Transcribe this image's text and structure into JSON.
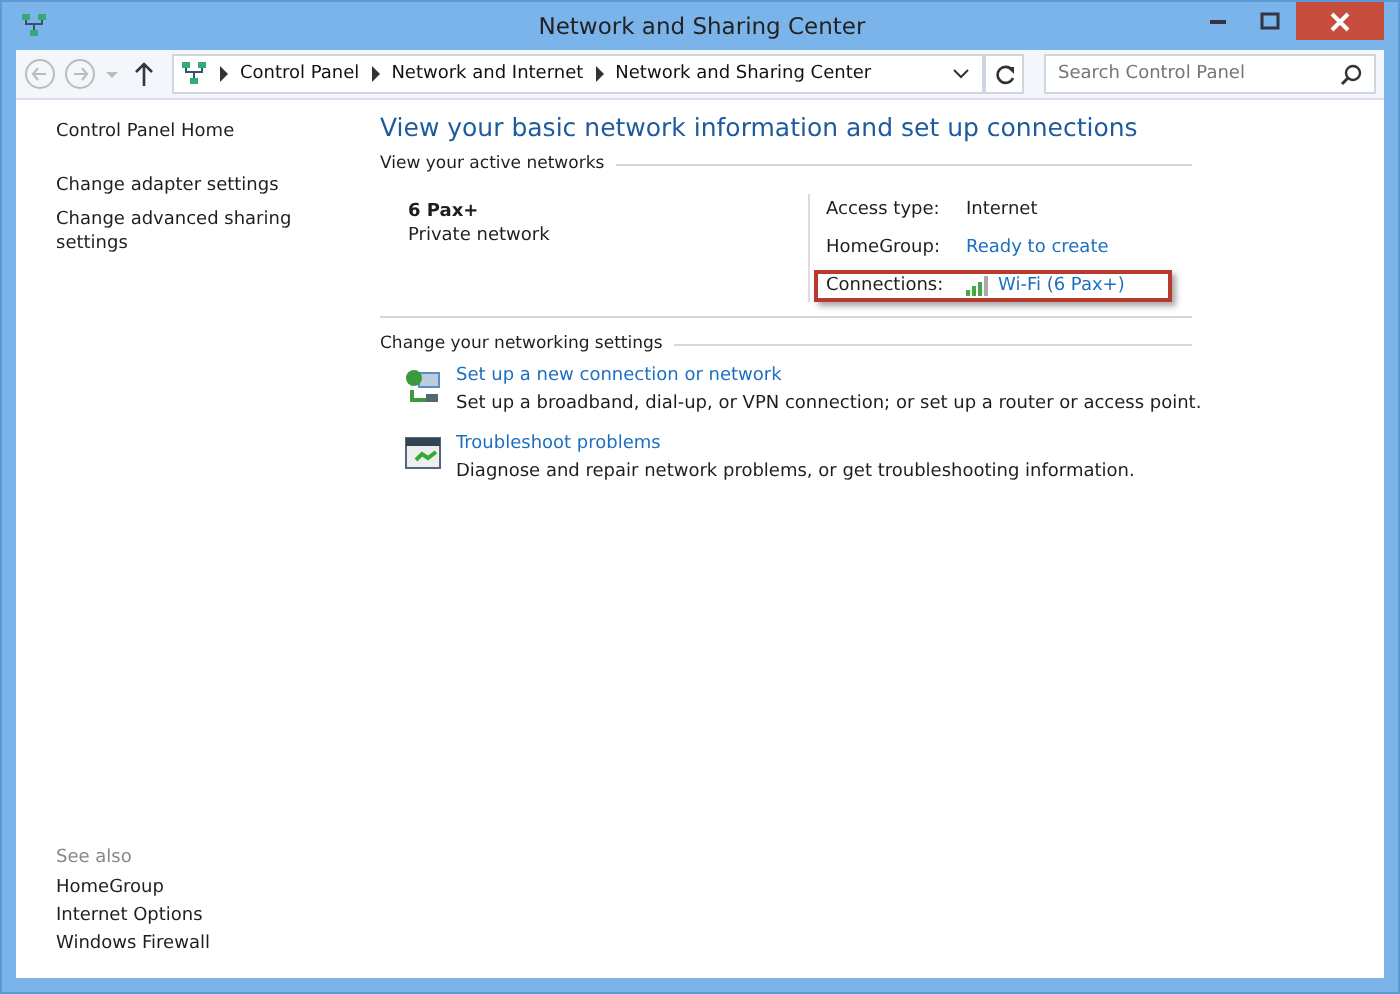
{
  "window": {
    "title": "Network and Sharing Center"
  },
  "address_bar": {
    "breadcrumb": [
      "Control Panel",
      "Network and Internet",
      "Network and Sharing Center"
    ]
  },
  "search": {
    "placeholder": "Search Control Panel"
  },
  "sidebar": {
    "items": [
      "Control Panel Home",
      "Change adapter settings",
      "Change advanced sharing settings"
    ],
    "see_also_heading": "See also",
    "see_also": [
      "HomeGroup",
      "Internet Options",
      "Windows Firewall"
    ]
  },
  "heading": "View your basic network information and set up connections",
  "active_networks": {
    "title": "View your active networks",
    "name": "6 Pax+",
    "type": "Private network",
    "details": [
      {
        "label": "Access type:",
        "value": "Internet",
        "kind": "text",
        "highlighted": false
      },
      {
        "label": "HomeGroup:",
        "value": "Ready to create",
        "kind": "link",
        "highlighted": false
      },
      {
        "label": "Connections:",
        "value": "Wi-Fi (6 Pax+)",
        "kind": "wifi",
        "highlighted": true
      }
    ]
  },
  "settings": {
    "title": "Change your networking settings",
    "items": [
      {
        "kind": "setup",
        "link": "Set up a new connection or network",
        "description": "Set up a broadband, dial-up, or VPN connection; or set up a router or access point."
      },
      {
        "kind": "troubleshoot",
        "link": "Troubleshoot problems",
        "description": "Diagnose and repair network problems, or get troubleshooting information."
      }
    ]
  }
}
